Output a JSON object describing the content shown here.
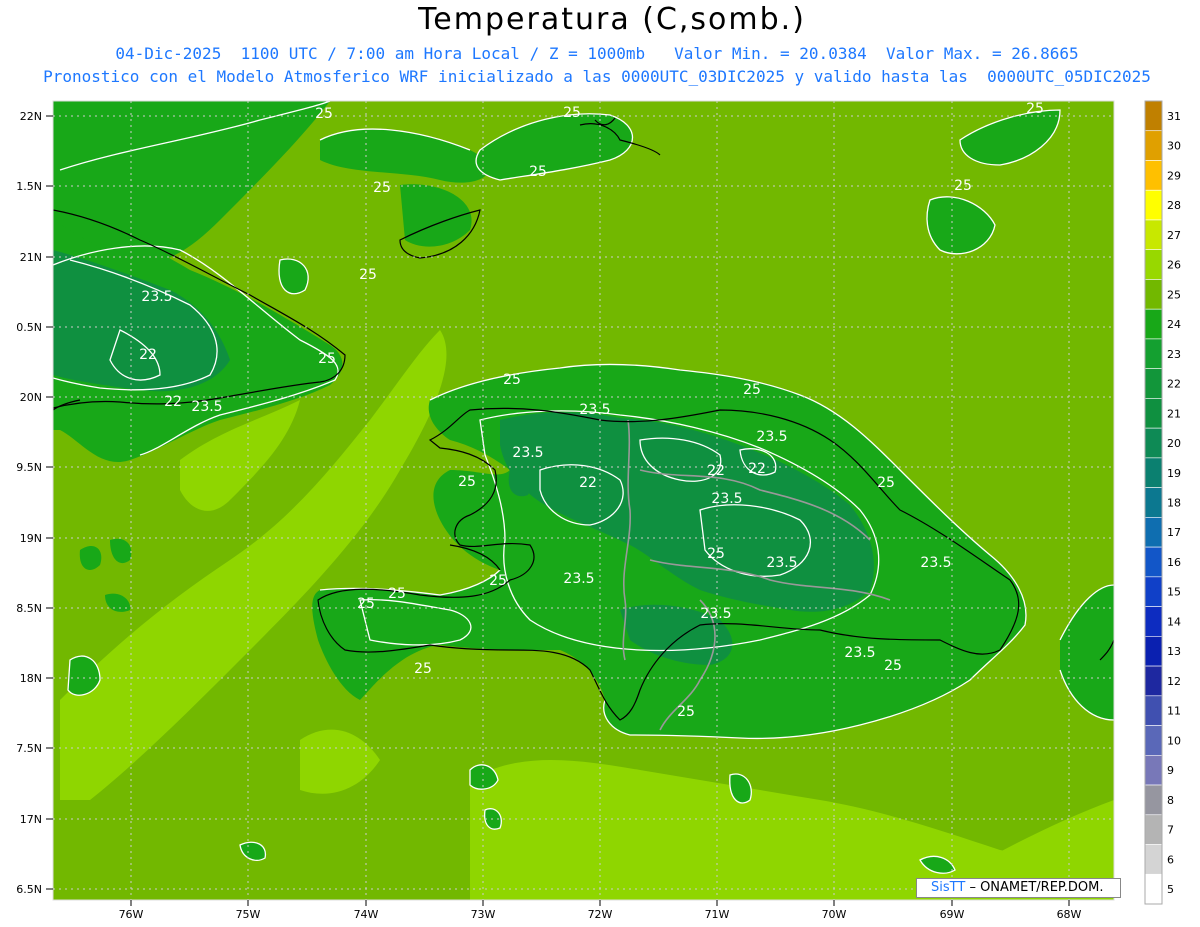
{
  "header": {
    "title": "Temperatura (C,somb.)",
    "line1": "04-Dic-2025  1100 UTC / 7:00 am Hora Local / Z = 1000mb   Valor Min. = 20.0384  Valor Max. = 26.8665",
    "line2": "Pronostico con el Modelo Atmosferico WRF inicializado a las 0000UTC_03DIC2025 y valido hasta las  0000UTC_05DIC2025"
  },
  "map": {
    "lat_labels": [
      "22N",
      "1.5N",
      "21N",
      "0.5N",
      "20N",
      "9.5N",
      "19N",
      "8.5N",
      "18N",
      "7.5N",
      "17N",
      "6.5N"
    ],
    "lon_labels": [
      "76W",
      "75W",
      "74W",
      "73W",
      "72W",
      "71W",
      "70W",
      "69W",
      "68W"
    ],
    "contour_labels": [
      "25",
      "25",
      "25",
      "25",
      "25",
      "25",
      "25",
      "25",
      "25",
      "25",
      "25",
      "25",
      "25",
      "25",
      "23.5",
      "23.5",
      "23.5",
      "23.5",
      "23.5",
      "23.5",
      "23.5",
      "23.5",
      "23.5",
      "23.5",
      "22",
      "22",
      "22",
      "22",
      "22"
    ],
    "colors": {
      "base_field": "#72b800",
      "warm_field": "#8fd600",
      "cool_field": "#18a818",
      "coolest_field": "#0f9040",
      "contour": "#ffffff",
      "coast": "#000000",
      "border": "#999999"
    }
  },
  "colorbar": {
    "levels": [
      "31",
      "30",
      "29",
      "28",
      "27",
      "26",
      "25",
      "24",
      "23",
      "22",
      "21",
      "20",
      "19",
      "18",
      "17",
      "16",
      "15",
      "14",
      "13",
      "12",
      "11",
      "10",
      "9",
      "8",
      "7",
      "6",
      "5"
    ],
    "colors": [
      "#c08000",
      "#e0a000",
      "#ffc000",
      "#ffff00",
      "#c8e800",
      "#98d800",
      "#72b800",
      "#18a818",
      "#14a030",
      "#12963a",
      "#0f9040",
      "#0e8a55",
      "#0b8070",
      "#0c7890",
      "#0f6eb0",
      "#1256c8",
      "#1040c8",
      "#0d2cc0",
      "#0a20b0",
      "#1e28a0",
      "#4050b0",
      "#5a68b8",
      "#7878b8",
      "#9696a0",
      "#b4b4b4",
      "#d4d4d4",
      "#ffffff"
    ]
  },
  "credit": {
    "logo": "SisTT",
    "text": "– ONAMET/REP.DOM."
  }
}
